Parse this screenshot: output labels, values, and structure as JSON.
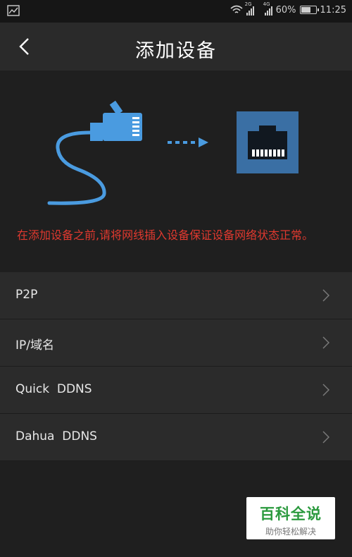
{
  "status_bar": {
    "network_tags": [
      "2G",
      "4G",
      "2G"
    ],
    "battery": "60%",
    "time": "11:25",
    "icons": [
      "gallery-icon",
      "wifi-icon",
      "signal-icon",
      "battery-icon"
    ]
  },
  "header": {
    "title": "添加设备",
    "back_icon": "back-arrow-icon"
  },
  "illustration": {
    "icons": [
      "ethernet-cable-icon",
      "dashed-arrow-icon",
      "ethernet-port-icon"
    ],
    "accent": "#4a9be0",
    "port_bg": "#3a6fa4"
  },
  "notice": "在添加设备之前,请将网线插入设备保证设备网络状态正常。",
  "menu": {
    "items": [
      {
        "label": "P2P"
      },
      {
        "label": "IP/域名"
      },
      {
        "label": "Quick  DDNS"
      },
      {
        "label": "Dahua  DDNS"
      }
    ]
  },
  "watermark": {
    "title": "百科全说",
    "subtitle": "助你轻松解决"
  },
  "colors": {
    "background": "#1f1f1f",
    "appbar": "#2a2a2a",
    "row": "#2b2b2b",
    "notice_red": "#e0392f",
    "watermark_green": "#2b9a3e"
  }
}
